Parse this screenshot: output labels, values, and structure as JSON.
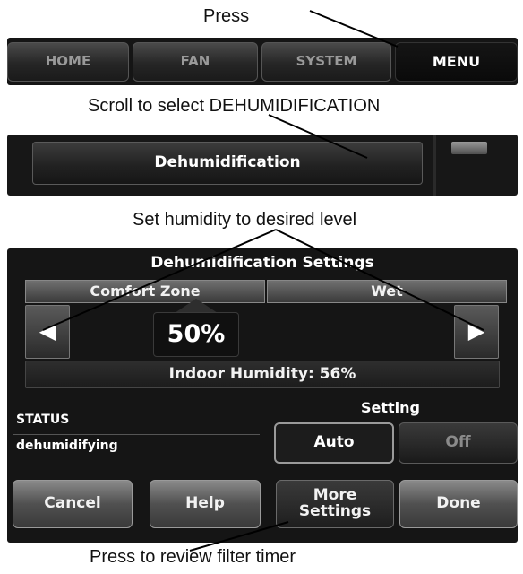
{
  "captions": {
    "press": "Press",
    "scroll": "Scroll to select DEHUMIDIFICATION",
    "set": "Set humidity to desired level",
    "review": "Press to review filter timer"
  },
  "nav": {
    "home": "HOME",
    "fan": "FAN",
    "system": "SYSTEM",
    "menu": "MENU"
  },
  "menu_list": {
    "item": "Dehumidification"
  },
  "dehum": {
    "title": "Dehumidification Settings",
    "tabs": [
      "Comfort Zone",
      "Wet"
    ],
    "value": "50%",
    "indoor_humidity": "Indoor Humidity: 56%",
    "status_label": "STATUS",
    "status_value": "dehumidifying",
    "setting_label": "Setting",
    "setting_options": [
      "Auto",
      "Off"
    ],
    "buttons": {
      "cancel": "Cancel",
      "help": "Help",
      "more": "More Settings",
      "done": "Done"
    }
  },
  "icons": {
    "left": "left-arrow-icon",
    "right": "right-arrow-icon",
    "up": "up-arrow-icon"
  }
}
